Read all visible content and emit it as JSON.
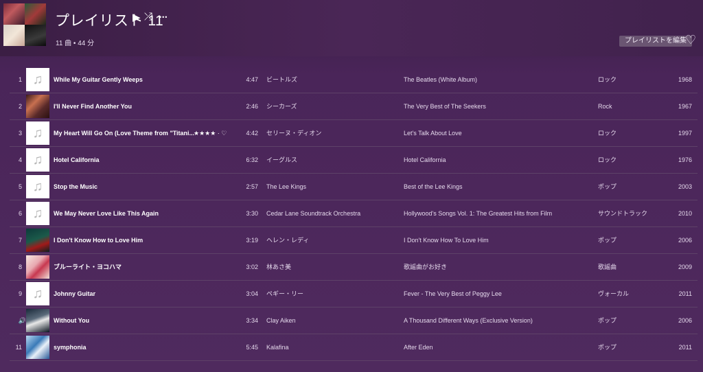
{
  "header": {
    "title": "プレイリスト 11",
    "play_icon": "▶",
    "shuffle_icon": "⤮",
    "more_icon": "•••",
    "subtitle": "11 曲 • 44 分",
    "edit_label": "プレイリストを編集",
    "heart_icon": "♡"
  },
  "tracks": [
    {
      "num": "1",
      "title": "While My Guitar Gently Weeps",
      "duration": "4:47",
      "artist": "ビートルズ",
      "album": "The Beatles (White Album)",
      "genre": "ロック",
      "year": "1968",
      "art": "blank"
    },
    {
      "num": "2",
      "title": "I'll Never Find Another You",
      "duration": "2:46",
      "artist": "シーカーズ",
      "album": "The Very Best of The Seekers",
      "genre": "Rock",
      "year": "1967",
      "art": "seekers"
    },
    {
      "num": "3",
      "title": "My Heart Will Go On (Love Theme from \"Titani...",
      "rating": "★★★★ · ♡",
      "duration": "4:42",
      "artist": "セリーヌ・ディオン",
      "album": "Let's Talk About Love",
      "genre": "ロック",
      "year": "1997",
      "art": "blank"
    },
    {
      "num": "4",
      "title": "Hotel California",
      "duration": "6:32",
      "artist": "イーグルス",
      "album": "Hotel California",
      "genre": "ロック",
      "year": "1976",
      "art": "blank"
    },
    {
      "num": "5",
      "title": "Stop the Music",
      "duration": "2:57",
      "artist": "The Lee Kings",
      "album": "Best of the Lee Kings",
      "genre": "ポップ",
      "year": "2003",
      "art": "blank"
    },
    {
      "num": "6",
      "title": "We May Never Love Like This Again",
      "duration": "3:30",
      "artist": "Cedar Lane Soundtrack Orchestra",
      "album": "Hollywood's Songs Vol. 1: The Greatest Hits from Film",
      "genre": "サウンドトラック",
      "year": "2010",
      "art": "blank"
    },
    {
      "num": "7",
      "title": "I Don't Know How to Love Him",
      "duration": "3:19",
      "artist": "ヘレン・レディ",
      "album": "I Don't Know How To Love Him",
      "genre": "ポップ",
      "year": "2006",
      "art": "reddy"
    },
    {
      "num": "8",
      "title": "ブルーライト・ヨコハマ",
      "duration": "3:02",
      "artist": "林あさ美",
      "album": "歌謡曲がお好き",
      "genre": "歌謡曲",
      "year": "2009",
      "art": "asami"
    },
    {
      "num": "9",
      "title": "Johnny Guitar",
      "duration": "3:04",
      "artist": "ペギー・リー",
      "album": "Fever - The Very Best of Peggy Lee",
      "genre": "ヴォーカル",
      "year": "2011",
      "art": "blank"
    },
    {
      "num": "🔊",
      "title": "Without You",
      "duration": "3:34",
      "artist": "Clay Aiken",
      "album": "A Thousand Different Ways (Exclusive Version)",
      "genre": "ポップ",
      "year": "2006",
      "art": "aiken"
    },
    {
      "num": "11",
      "title": "symphonia",
      "duration": "5:45",
      "artist": "Kalafina",
      "album": "After Eden",
      "genre": "ポップ",
      "year": "2011",
      "art": "kalafina"
    }
  ],
  "music_note_icon": "♫"
}
